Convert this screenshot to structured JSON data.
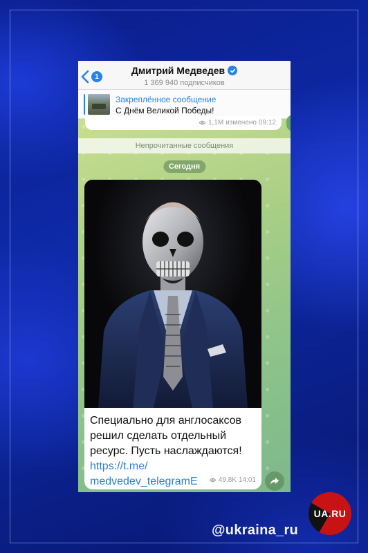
{
  "header": {
    "back_badge": "1",
    "channel_name": "Дмитрий Медведев",
    "subscribers": "1 369 940 подписчиков"
  },
  "pinned": {
    "label": "Закреплённое сообщение",
    "text": "С Днём Великой Победы!"
  },
  "previous_message": {
    "views": "1,1M",
    "edited": "изменено",
    "time": "09:12"
  },
  "unread_divider": "Непрочитанные сообщения",
  "date_separator": "Сегодня",
  "post": {
    "text_lines": [
      "Специально для англосаксов",
      "решил сделать отдельный",
      "ресурс. Пусть наслаждаются!"
    ],
    "link_lines": [
      "https://t.me/",
      "medvedev_telegramE"
    ],
    "views": "49,8K",
    "time": "14:01"
  },
  "watermark": {
    "logo_text": "UA.RU",
    "handle": "@ukraina_ru"
  },
  "colors": {
    "accent": "#2a82e6",
    "link": "#2a7ed6",
    "page_background": "#0a1f8f",
    "logo_red": "#c71313"
  },
  "icons": [
    "back-chevron-icon",
    "verified-icon",
    "eye-icon",
    "share-icon"
  ]
}
